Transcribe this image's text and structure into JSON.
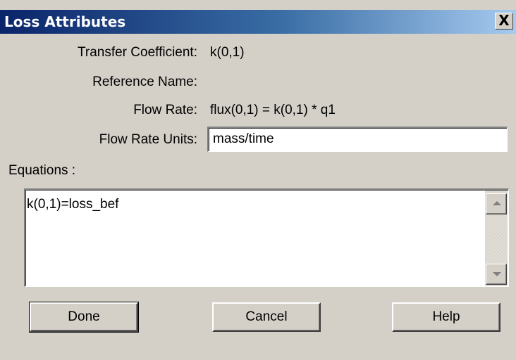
{
  "window": {
    "title": "Loss Attributes",
    "close_symbol": "X"
  },
  "fields": [
    {
      "label": "Transfer Coefficient:",
      "value": "k(0,1)"
    },
    {
      "label": "Reference Name:",
      "value": ""
    },
    {
      "label": "Flow Rate:",
      "value": "flux(0,1) = k(0,1) * q1"
    }
  ],
  "flow_rate_units": {
    "label": "Flow Rate Units:",
    "value": "mass/time"
  },
  "equations": {
    "label": "Equations :",
    "text": "k(0,1)=loss_bef"
  },
  "buttons": {
    "done": "Done",
    "cancel": "Cancel",
    "help": "Help"
  }
}
